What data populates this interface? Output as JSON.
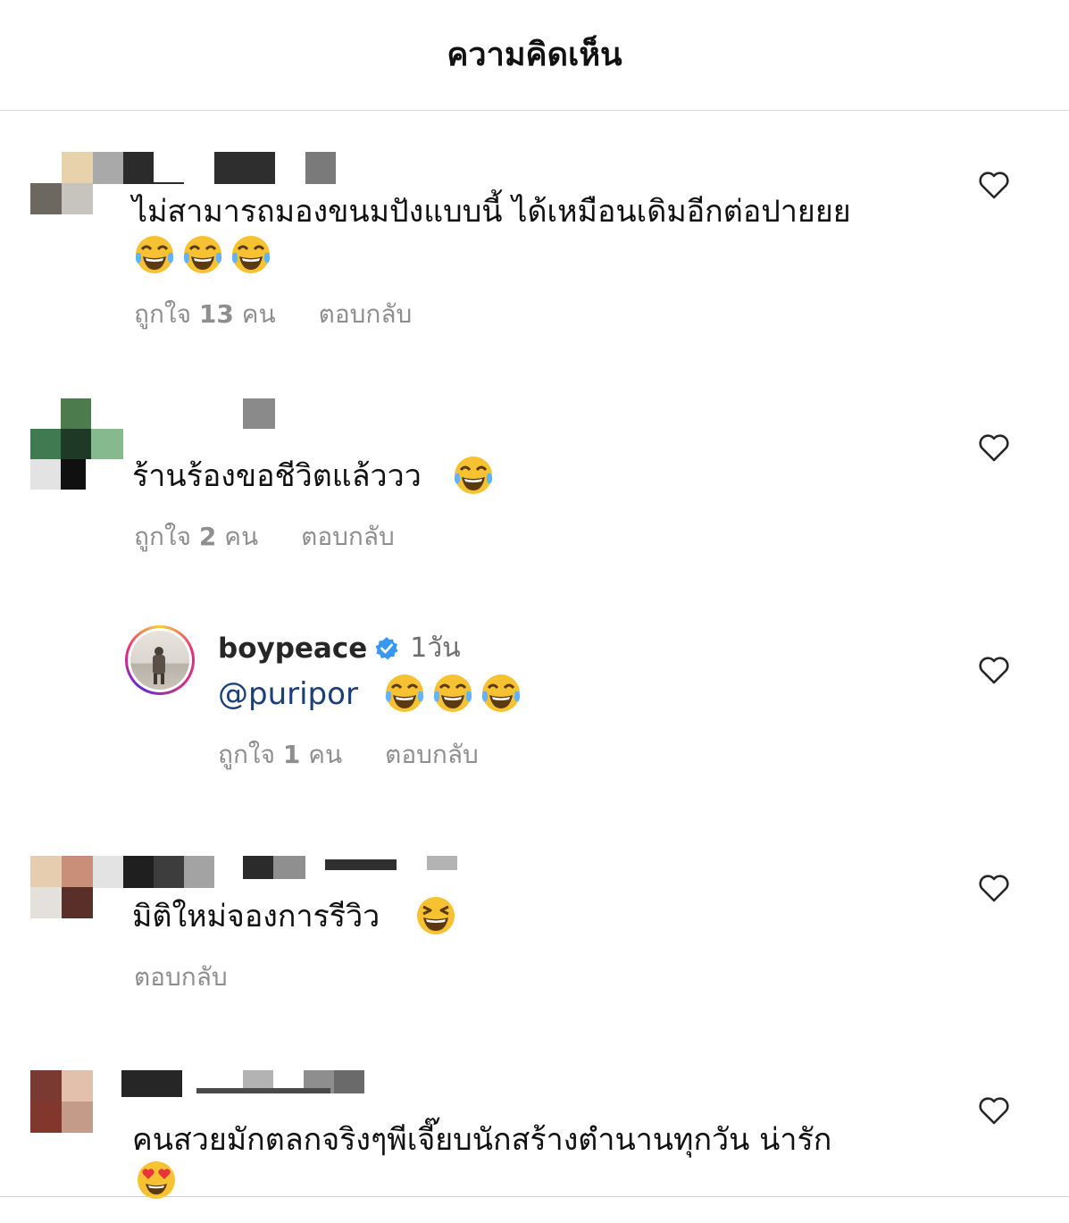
{
  "header": {
    "title": "ความคิดเห็น"
  },
  "comments": [
    {
      "text": "ไม่สามารถมองขนมปังแบบนี้ ได้เหมือนเดิมอีกต่อปายยย",
      "emojis": [
        "face-with-tears-of-joy",
        "face-with-tears-of-joy",
        "face-with-tears-of-joy"
      ],
      "likes_prefix": "ถูกใจ",
      "likes_count": "13",
      "likes_suffix": "คน",
      "reply_label": "ตอบกลับ"
    },
    {
      "text": "ร้านร้องขอชีวิตแล้ววว",
      "emojis": [
        "face-with-tears-of-joy"
      ],
      "likes_prefix": "ถูกใจ",
      "likes_count": "2",
      "likes_suffix": "คน",
      "reply_label": "ตอบกลับ"
    },
    {
      "text": "มิติใหม่จองการรีวิว",
      "emojis": [
        "grinning-squinting-face"
      ],
      "reply_label": "ตอบกลับ"
    },
    {
      "text": "คนสวยมักตลกจริงๆพีเจี๊ยบนักสร้างตำนานทุกวัน น่ารัก",
      "emojis": [
        "smiling-face-with-heart-eyes"
      ]
    }
  ],
  "reply": {
    "username": "boypeace",
    "verified": true,
    "time": "1วัน",
    "mention": "@puripor",
    "emojis": [
      "face-with-tears-of-joy",
      "face-with-tears-of-joy",
      "face-with-tears-of-joy"
    ],
    "likes_prefix": "ถูกใจ",
    "likes_count": "1",
    "likes_suffix": "คน",
    "reply_label": "ตอบกลับ"
  },
  "colors": {
    "meta_gray": "#8e8e8e",
    "mention_blue": "#1b3f7a",
    "verified_blue": "#3897f0",
    "emoji_yellow": "#f7c232",
    "tear_blue": "#5fb4ff"
  },
  "icons": [
    "heart-outline-icon",
    "verified-badge-icon"
  ]
}
